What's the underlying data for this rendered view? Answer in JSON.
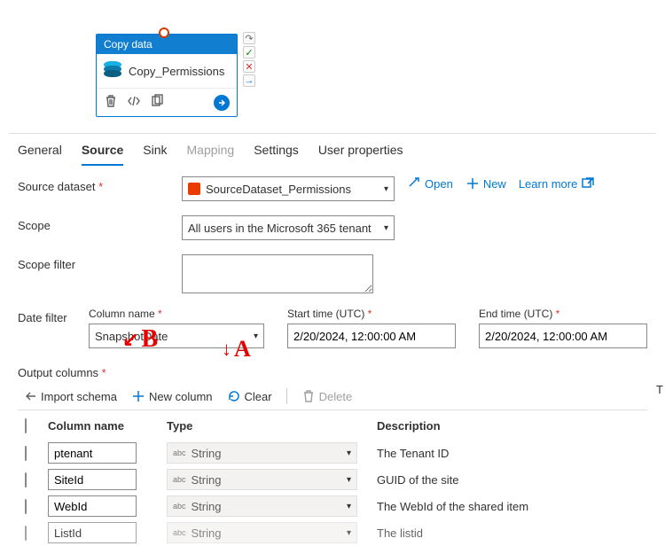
{
  "canvas": {
    "activity_title": "Copy data",
    "activity_name": "Copy_Permissions"
  },
  "tabs": {
    "general": "General",
    "source": "Source",
    "sink": "Sink",
    "mapping": "Mapping",
    "settings": "Settings",
    "user_properties": "User properties"
  },
  "form": {
    "source_dataset_label": "Source dataset",
    "source_dataset_value": "SourceDataset_Permissions",
    "open": "Open",
    "new": "New",
    "learn_more": "Learn more",
    "scope_label": "Scope",
    "scope_value": "All users in the Microsoft 365 tenant",
    "scope_filter_label": "Scope filter",
    "date_filter_label": "Date filter",
    "column_name_label": "Column name",
    "column_name_value": "SnapshotDate",
    "start_label": "Start time (UTC)",
    "start_value": "2/20/2024, 12:00:00 AM",
    "end_label": "End time (UTC)",
    "end_value": "2/20/2024, 12:00:00 AM",
    "output_columns_label": "Output columns"
  },
  "commands": {
    "import_schema": "Import schema",
    "new_column": "New column",
    "clear": "Clear",
    "delete": "Delete"
  },
  "table": {
    "headers": {
      "name": "Column name",
      "type": "Type",
      "desc": "Description"
    },
    "rows": [
      {
        "name": "ptenant",
        "type": "String",
        "desc": "The Tenant ID"
      },
      {
        "name": "SiteId",
        "type": "String",
        "desc": "GUID of the site"
      },
      {
        "name": "WebId",
        "type": "String",
        "desc": "The WebId of the shared item"
      },
      {
        "name": "ListId",
        "type": "String",
        "desc": "The listid"
      }
    ]
  },
  "annotations": {
    "a": "A",
    "b": "B"
  },
  "overflow_T": "T"
}
